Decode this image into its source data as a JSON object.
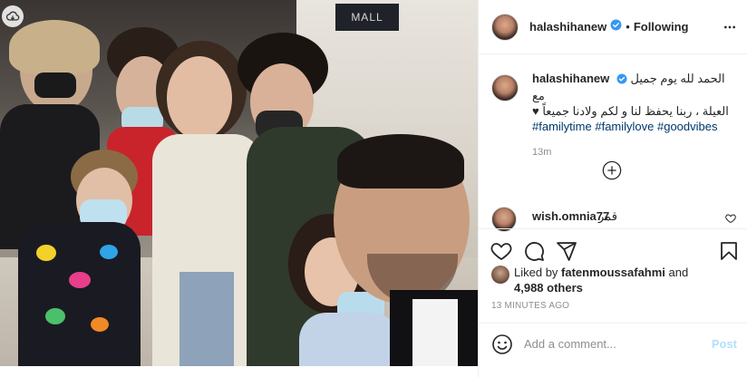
{
  "photo": {
    "sign_text": "MALL"
  },
  "header": {
    "username": "halashihanew",
    "separator": "•",
    "follow_status": "Following"
  },
  "caption": {
    "username": "halashihanew",
    "line1": "الحمد لله يوم جميل مع",
    "line2": "العيلة ، ربنا يحفظ لنا و لكم ولادنا جميعاً ♥",
    "hashtags": "#familytime #familylove #goodvibes",
    "time": "13m"
  },
  "comment": {
    "username": "wish.omnia77",
    "text": "قمر"
  },
  "likes": {
    "prefix": "Liked by",
    "user": "fatenmoussafahmi",
    "and": "and",
    "others": "4,988 others"
  },
  "timestamp": "13 MINUTES AGO",
  "add_comment": {
    "placeholder": "Add a comment...",
    "post_label": "Post"
  },
  "icons": {
    "verified": "verified-badge-icon",
    "more": "more-options-icon",
    "plus": "load-more-comments-icon",
    "heart": "heart-icon",
    "comment": "comment-icon",
    "share": "share-icon",
    "save": "bookmark-icon",
    "emoji": "emoji-icon",
    "cloud": "cloud-icon"
  },
  "colors": {
    "verified_blue": "#3897f0",
    "link_blue": "#00376b",
    "post_disabled": "#b2dffc",
    "muted": "#8e8e8e"
  }
}
